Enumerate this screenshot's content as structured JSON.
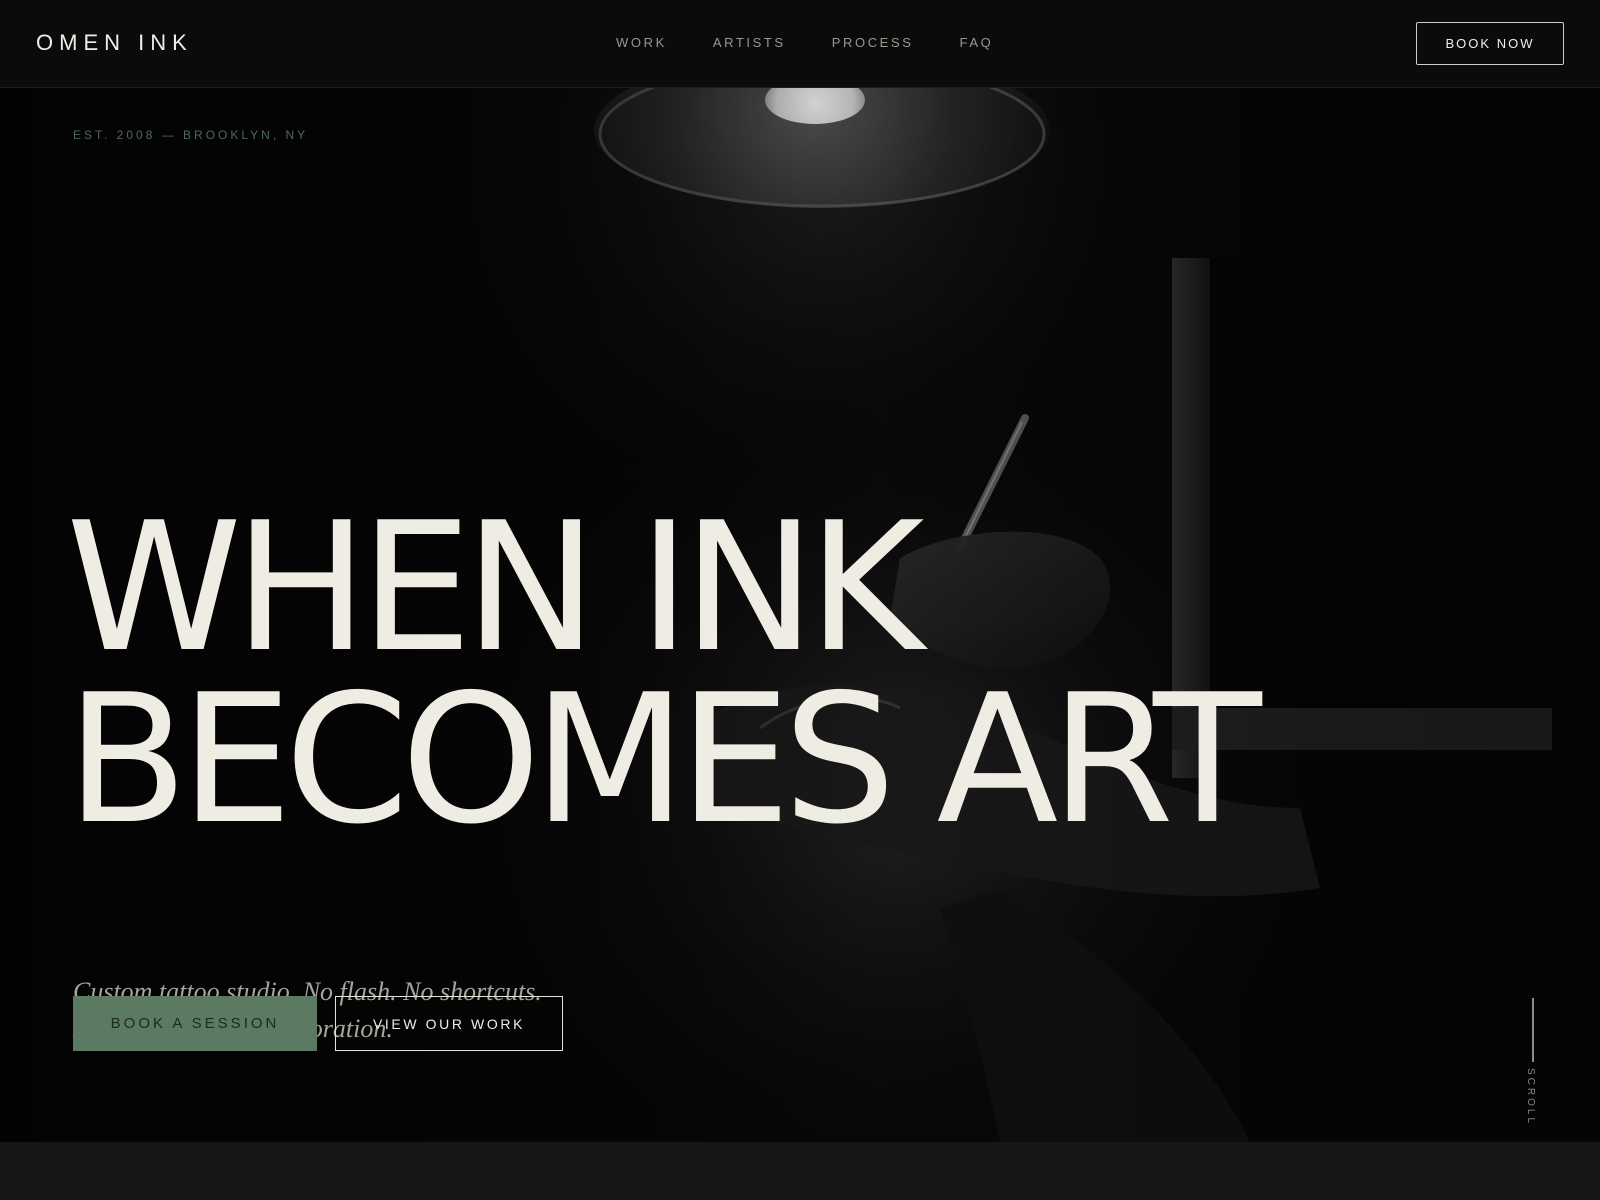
{
  "header": {
    "logo": "OMEN INK",
    "nav": [
      "WORK",
      "ARTISTS",
      "PROCESS",
      "FAQ"
    ],
    "cta_label": "BOOK NOW"
  },
  "hero": {
    "established": "EST. 2008 — BROOKLYN, NY",
    "headline_line1": "WHEN INK",
    "headline_line2": "BECOMES ART",
    "subtitle_line1": "Custom tattoo studio. No flash. No shortcuts.",
    "subtitle_line2": "Every piece is a collaboration.",
    "primary_button": "BOOK A SESSION",
    "secondary_button": "VIEW OUR WORK",
    "scroll_label": "SCROLL"
  },
  "colors": {
    "background": "#0a0a0a",
    "text": "#efece4",
    "accent_green": "#5b7a61",
    "muted_green": "#4e6a55",
    "nav_gray": "#9a978f"
  }
}
